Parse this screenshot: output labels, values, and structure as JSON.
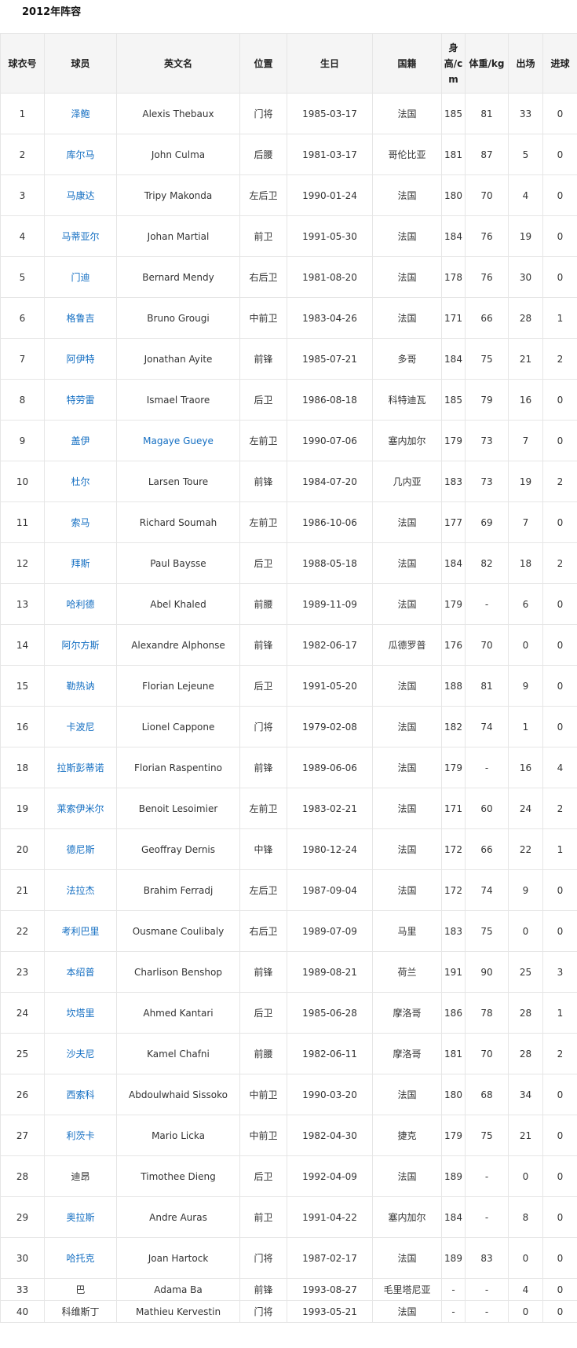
{
  "title": "2012年阵容",
  "colors": {
    "link": "#136ec2",
    "text": "#333333",
    "header_bg": "#f5f5f5",
    "border": "#e6e6e6"
  },
  "headers": [
    "球衣号",
    "球员",
    "英文名",
    "位置",
    "生日",
    "国籍",
    "身高/cm",
    "体重/kg",
    "出场",
    "进球"
  ],
  "rows": [
    {
      "num": "1",
      "name": "泽鲍",
      "en": "Alexis Thebaux",
      "pos": "门将",
      "birth": "1985-03-17",
      "nat": "法国",
      "height": "185",
      "weight": "81",
      "apps": "33",
      "goals": "0",
      "name_link": true,
      "en_link": false
    },
    {
      "num": "2",
      "name": "库尔马",
      "en": "John Culma",
      "pos": "后腰",
      "birth": "1981-03-17",
      "nat": "哥伦比亚",
      "height": "181",
      "weight": "87",
      "apps": "5",
      "goals": "0",
      "name_link": true,
      "en_link": false
    },
    {
      "num": "3",
      "name": "马康达",
      "en": "Tripy Makonda",
      "pos": "左后卫",
      "birth": "1990-01-24",
      "nat": "法国",
      "height": "180",
      "weight": "70",
      "apps": "4",
      "goals": "0",
      "name_link": true,
      "en_link": false
    },
    {
      "num": "4",
      "name": "马蒂亚尔",
      "en": "Johan Martial",
      "pos": "前卫",
      "birth": "1991-05-30",
      "nat": "法国",
      "height": "184",
      "weight": "76",
      "apps": "19",
      "goals": "0",
      "name_link": true,
      "en_link": false
    },
    {
      "num": "5",
      "name": "门迪",
      "en": "Bernard Mendy",
      "pos": "右后卫",
      "birth": "1981-08-20",
      "nat": "法国",
      "height": "178",
      "weight": "76",
      "apps": "30",
      "goals": "0",
      "name_link": true,
      "en_link": false
    },
    {
      "num": "6",
      "name": "格鲁吉",
      "en": "Bruno Grougi",
      "pos": "中前卫",
      "birth": "1983-04-26",
      "nat": "法国",
      "height": "171",
      "weight": "66",
      "apps": "28",
      "goals": "1",
      "name_link": true,
      "en_link": false
    },
    {
      "num": "7",
      "name": "阿伊特",
      "en": "Jonathan Ayite",
      "pos": "前锋",
      "birth": "1985-07-21",
      "nat": "多哥",
      "height": "184",
      "weight": "75",
      "apps": "21",
      "goals": "2",
      "name_link": true,
      "en_link": false
    },
    {
      "num": "8",
      "name": "特劳雷",
      "en": "Ismael Traore",
      "pos": "后卫",
      "birth": "1986-08-18",
      "nat": "科特迪瓦",
      "height": "185",
      "weight": "79",
      "apps": "16",
      "goals": "0",
      "name_link": true,
      "en_link": false
    },
    {
      "num": "9",
      "name": "盖伊",
      "en": "Magaye Gueye",
      "pos": "左前卫",
      "birth": "1990-07-06",
      "nat": "塞内加尔",
      "height": "179",
      "weight": "73",
      "apps": "7",
      "goals": "0",
      "name_link": true,
      "en_link": true
    },
    {
      "num": "10",
      "name": "杜尔",
      "en": "Larsen Toure",
      "pos": "前锋",
      "birth": "1984-07-20",
      "nat": "几内亚",
      "height": "183",
      "weight": "73",
      "apps": "19",
      "goals": "2",
      "name_link": true,
      "en_link": false
    },
    {
      "num": "11",
      "name": "索马",
      "en": "Richard Soumah",
      "pos": "左前卫",
      "birth": "1986-10-06",
      "nat": "法国",
      "height": "177",
      "weight": "69",
      "apps": "7",
      "goals": "0",
      "name_link": true,
      "en_link": false
    },
    {
      "num": "12",
      "name": "拜斯",
      "en": "Paul Baysse",
      "pos": "后卫",
      "birth": "1988-05-18",
      "nat": "法国",
      "height": "184",
      "weight": "82",
      "apps": "18",
      "goals": "2",
      "name_link": true,
      "en_link": false
    },
    {
      "num": "13",
      "name": "哈利德",
      "en": "Abel Khaled",
      "pos": "前腰",
      "birth": "1989-11-09",
      "nat": "法国",
      "height": "179",
      "weight": "-",
      "apps": "6",
      "goals": "0",
      "name_link": true,
      "en_link": false
    },
    {
      "num": "14",
      "name": "阿尔方斯",
      "en": "Alexandre Alphonse",
      "pos": "前锋",
      "birth": "1982-06-17",
      "nat": "瓜德罗普",
      "height": "176",
      "weight": "70",
      "apps": "0",
      "goals": "0",
      "name_link": true,
      "en_link": false
    },
    {
      "num": "15",
      "name": "勒热讷",
      "en": "Florian Lejeune",
      "pos": "后卫",
      "birth": "1991-05-20",
      "nat": "法国",
      "height": "188",
      "weight": "81",
      "apps": "9",
      "goals": "0",
      "name_link": true,
      "en_link": false
    },
    {
      "num": "16",
      "name": "卡波尼",
      "en": "Lionel Cappone",
      "pos": "门将",
      "birth": "1979-02-08",
      "nat": "法国",
      "height": "182",
      "weight": "74",
      "apps": "1",
      "goals": "0",
      "name_link": true,
      "en_link": false
    },
    {
      "num": "18",
      "name": "拉斯彭蒂诺",
      "en": "Florian Raspentino",
      "pos": "前锋",
      "birth": "1989-06-06",
      "nat": "法国",
      "height": "179",
      "weight": "-",
      "apps": "16",
      "goals": "4",
      "name_link": true,
      "en_link": false
    },
    {
      "num": "19",
      "name": "莱索伊米尔",
      "en": "Benoit Lesoimier",
      "pos": "左前卫",
      "birth": "1983-02-21",
      "nat": "法国",
      "height": "171",
      "weight": "60",
      "apps": "24",
      "goals": "2",
      "name_link": true,
      "en_link": false
    },
    {
      "num": "20",
      "name": "德尼斯",
      "en": "Geoffray Dernis",
      "pos": "中锋",
      "birth": "1980-12-24",
      "nat": "法国",
      "height": "172",
      "weight": "66",
      "apps": "22",
      "goals": "1",
      "name_link": true,
      "en_link": false
    },
    {
      "num": "21",
      "name": "法拉杰",
      "en": "Brahim Ferradj",
      "pos": "左后卫",
      "birth": "1987-09-04",
      "nat": "法国",
      "height": "172",
      "weight": "74",
      "apps": "9",
      "goals": "0",
      "name_link": true,
      "en_link": false
    },
    {
      "num": "22",
      "name": "考利巴里",
      "en": "Ousmane Coulibaly",
      "pos": "右后卫",
      "birth": "1989-07-09",
      "nat": "马里",
      "height": "183",
      "weight": "75",
      "apps": "0",
      "goals": "0",
      "name_link": true,
      "en_link": false
    },
    {
      "num": "23",
      "name": "本绍普",
      "en": "Charlison Benshop",
      "pos": "前锋",
      "birth": "1989-08-21",
      "nat": "荷兰",
      "height": "191",
      "weight": "90",
      "apps": "25",
      "goals": "3",
      "name_link": true,
      "en_link": false
    },
    {
      "num": "24",
      "name": "坎塔里",
      "en": "Ahmed Kantari",
      "pos": "后卫",
      "birth": "1985-06-28",
      "nat": "摩洛哥",
      "height": "186",
      "weight": "78",
      "apps": "28",
      "goals": "1",
      "name_link": true,
      "en_link": false
    },
    {
      "num": "25",
      "name": "沙夫尼",
      "en": "Kamel Chafni",
      "pos": "前腰",
      "birth": "1982-06-11",
      "nat": "摩洛哥",
      "height": "181",
      "weight": "70",
      "apps": "28",
      "goals": "2",
      "name_link": true,
      "en_link": false
    },
    {
      "num": "26",
      "name": "西索科",
      "en": "Abdoulwhaid Sissoko",
      "pos": "中前卫",
      "birth": "1990-03-20",
      "nat": "法国",
      "height": "180",
      "weight": "68",
      "apps": "34",
      "goals": "0",
      "name_link": true,
      "en_link": false
    },
    {
      "num": "27",
      "name": "利茨卡",
      "en": "Mario Licka",
      "pos": "中前卫",
      "birth": "1982-04-30",
      "nat": "捷克",
      "height": "179",
      "weight": "75",
      "apps": "21",
      "goals": "0",
      "name_link": true,
      "en_link": false
    },
    {
      "num": "28",
      "name": "迪昂",
      "en": "Timothee Dieng",
      "pos": "后卫",
      "birth": "1992-04-09",
      "nat": "法国",
      "height": "189",
      "weight": "-",
      "apps": "0",
      "goals": "0",
      "name_link": false,
      "en_link": false
    },
    {
      "num": "29",
      "name": "奥拉斯",
      "en": "Andre Auras",
      "pos": "前卫",
      "birth": "1991-04-22",
      "nat": "塞内加尔",
      "height": "184",
      "weight": "-",
      "apps": "8",
      "goals": "0",
      "name_link": true,
      "en_link": false
    },
    {
      "num": "30",
      "name": "哈托克",
      "en": "Joan Hartock",
      "pos": "门将",
      "birth": "1987-02-17",
      "nat": "法国",
      "height": "189",
      "weight": "83",
      "apps": "0",
      "goals": "0",
      "name_link": true,
      "en_link": false
    },
    {
      "num": "33",
      "name": "巴",
      "en": "Adama Ba",
      "pos": "前锋",
      "birth": "1993-08-27",
      "nat": "毛里塔尼亚",
      "height": "-",
      "weight": "-",
      "apps": "4",
      "goals": "0",
      "name_link": false,
      "en_link": false
    },
    {
      "num": "40",
      "name": "科维斯丁",
      "en": "Mathieu Kervestin",
      "pos": "门将",
      "birth": "1993-05-21",
      "nat": "法国",
      "height": "-",
      "weight": "-",
      "apps": "0",
      "goals": "0",
      "name_link": false,
      "en_link": false
    }
  ]
}
